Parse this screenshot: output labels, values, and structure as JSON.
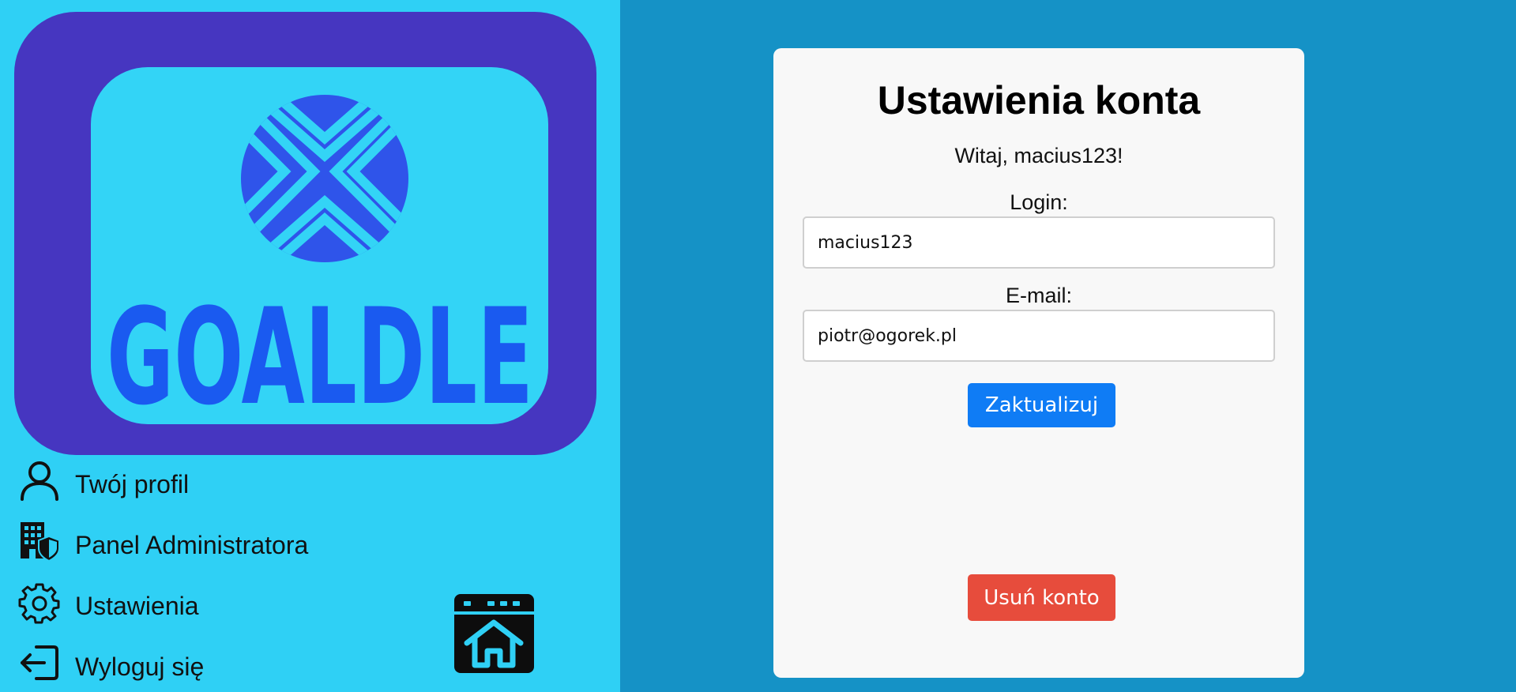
{
  "logo": {
    "text": "GOALDLE",
    "colors": {
      "outer": "#4636c0",
      "inner": "#33d4f6",
      "mark": "#2f54ea",
      "text": "#1a5af0"
    }
  },
  "sidebar": {
    "items": [
      {
        "label": "Twój profil",
        "icon": "user-icon"
      },
      {
        "label": "Panel Administratora",
        "icon": "admin-building-shield-icon"
      },
      {
        "label": "Ustawienia",
        "icon": "gear-icon"
      },
      {
        "label": "Wyloguj się",
        "icon": "logout-icon"
      }
    ],
    "home_button_icon": "home-window-icon"
  },
  "card": {
    "title": "Ustawienia konta",
    "greeting": "Witaj, macius123!",
    "login_label": "Login:",
    "login_value": "macius123",
    "email_label": "E-mail:",
    "email_value": "piotr@ogorek.pl",
    "update_button": "Zaktualizuj",
    "delete_button": "Usuń konto"
  },
  "colors": {
    "sidebar_bg": "#2fd0f5",
    "main_bg": "#1592c6",
    "card_bg": "#f8f8f8",
    "update_button": "#0f7cf5",
    "delete_button": "#e74c3c"
  }
}
